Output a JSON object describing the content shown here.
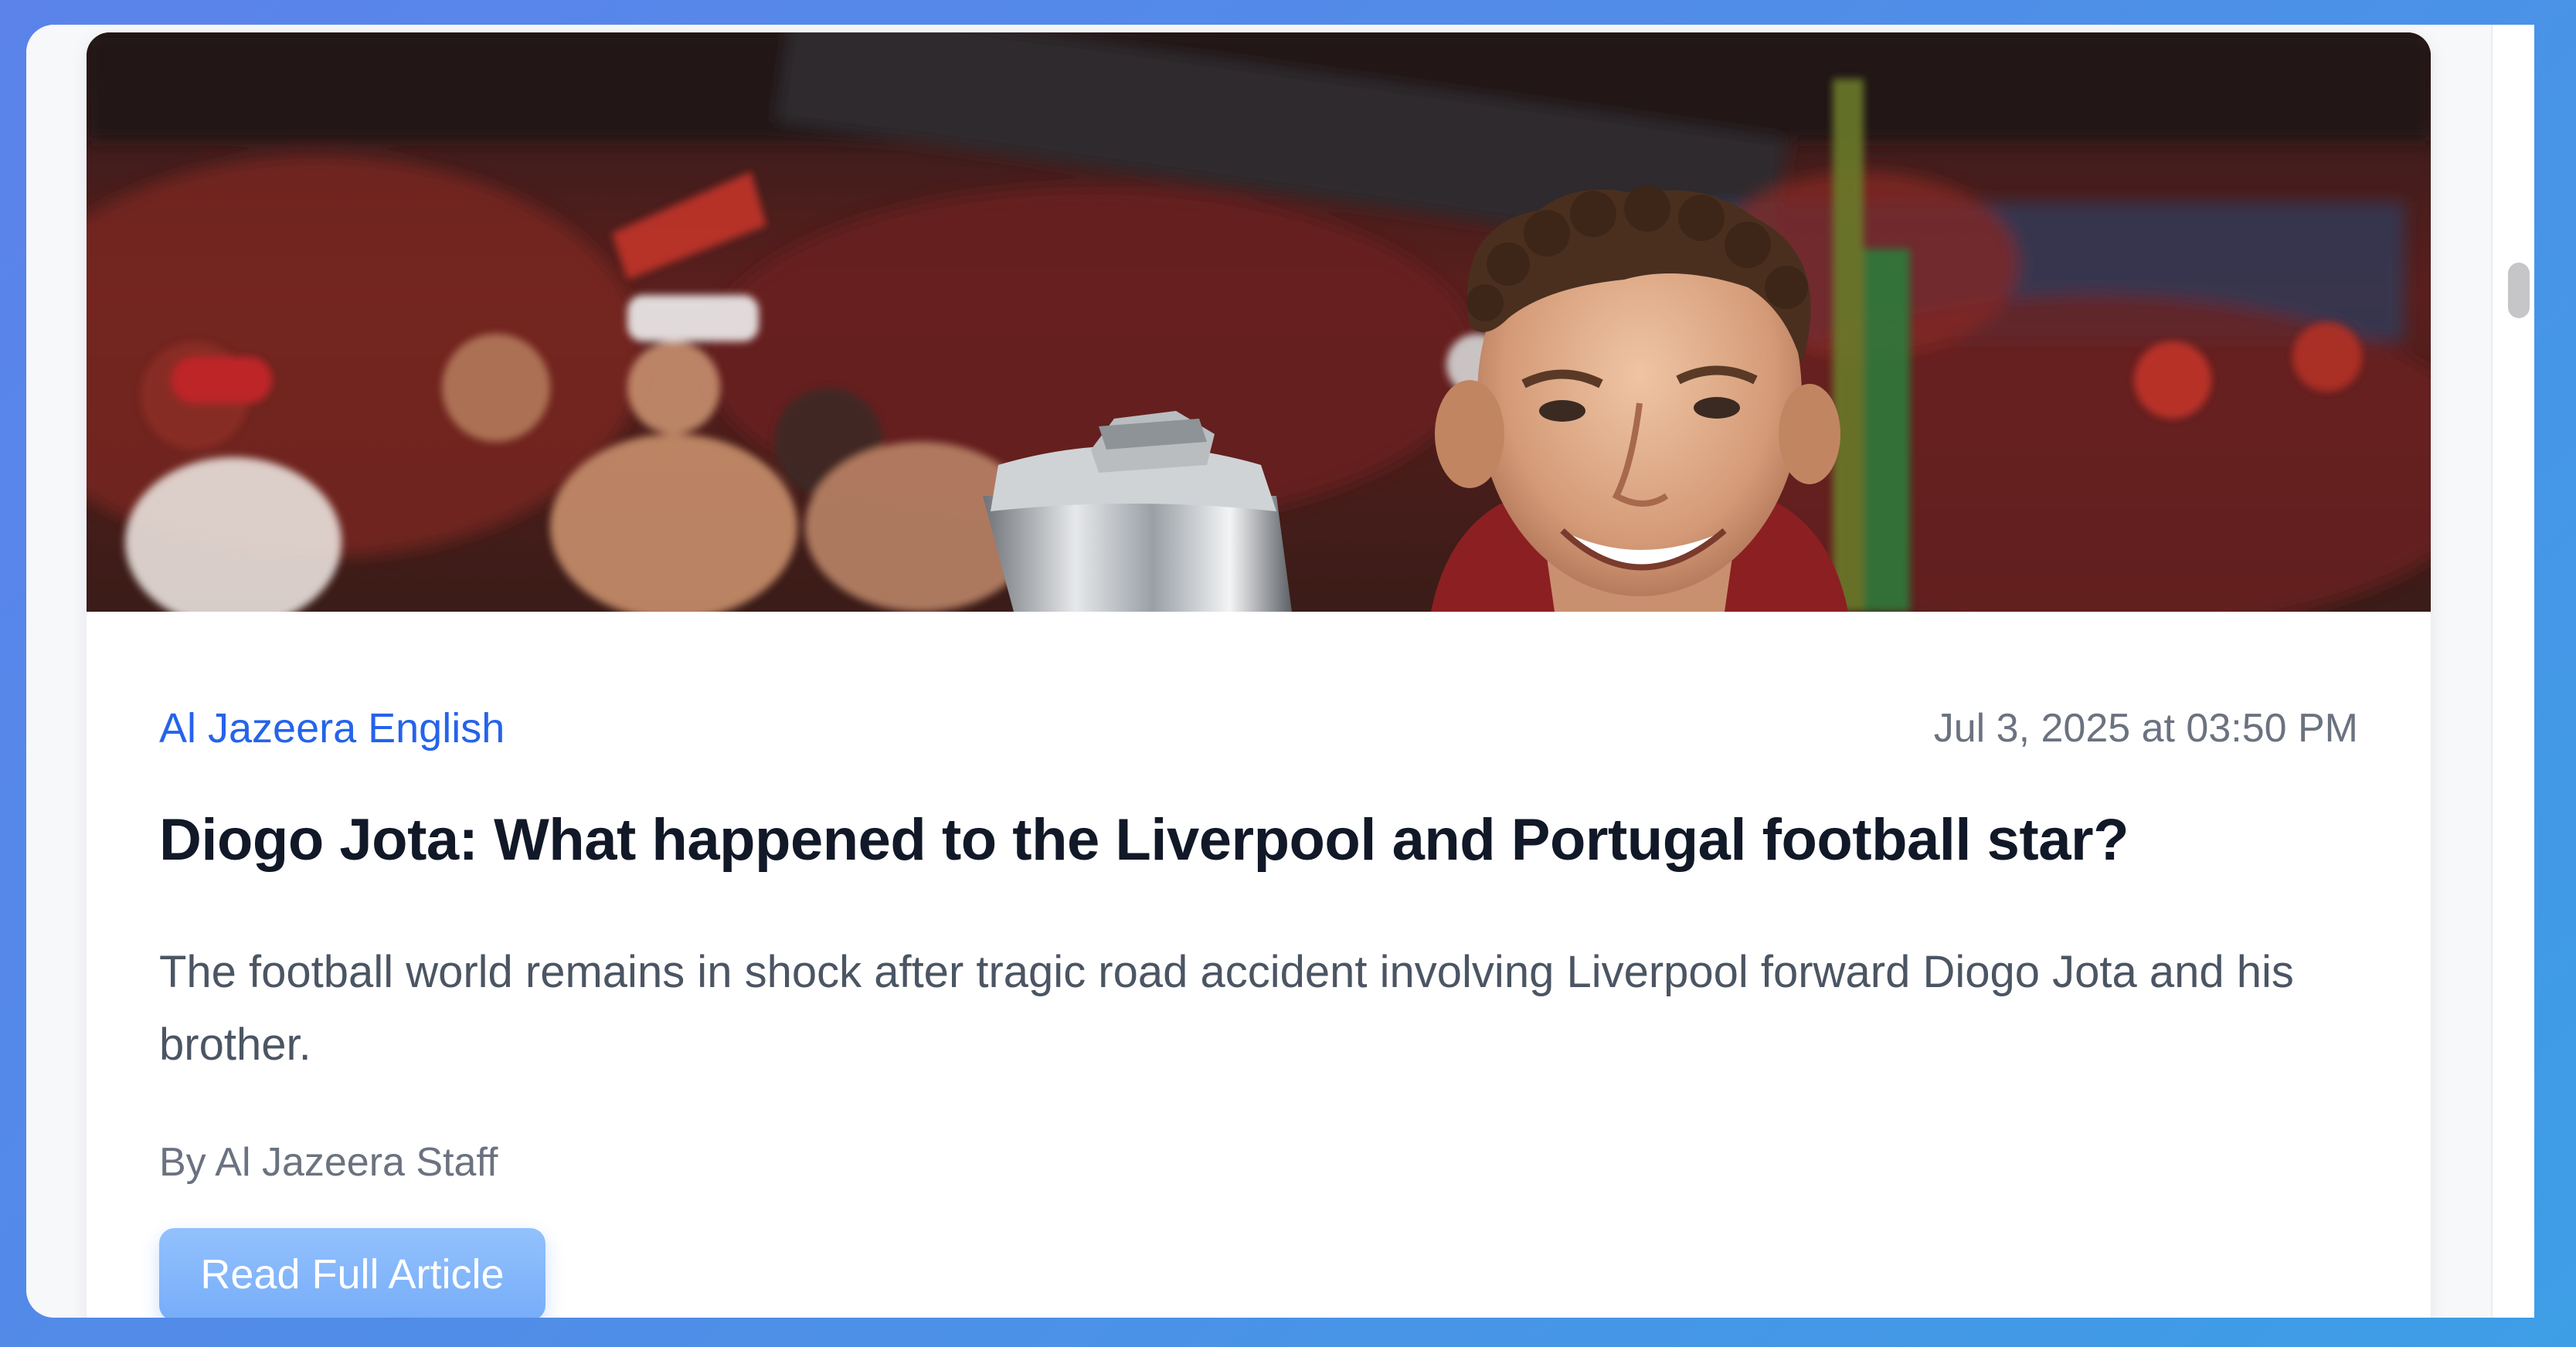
{
  "article": {
    "image_alt": "Diogo Jota smiling with a trophy in a stadium",
    "source": "Al Jazeera English",
    "date": "Jul 3, 2025 at 03:50 PM",
    "title": "Diogo Jota: What happened to the Liverpool and Portugal football star?",
    "summary": "The football world remains in shock after tragic road accident involving Liverpool forward Diogo Jota and his brother.",
    "byline": "By Al Jazeera Staff",
    "cta_label": "Read Full Article"
  },
  "colors": {
    "accent": "#2563eb",
    "button": "#86b7fb",
    "title": "#111827",
    "muted": "#6b7280"
  }
}
